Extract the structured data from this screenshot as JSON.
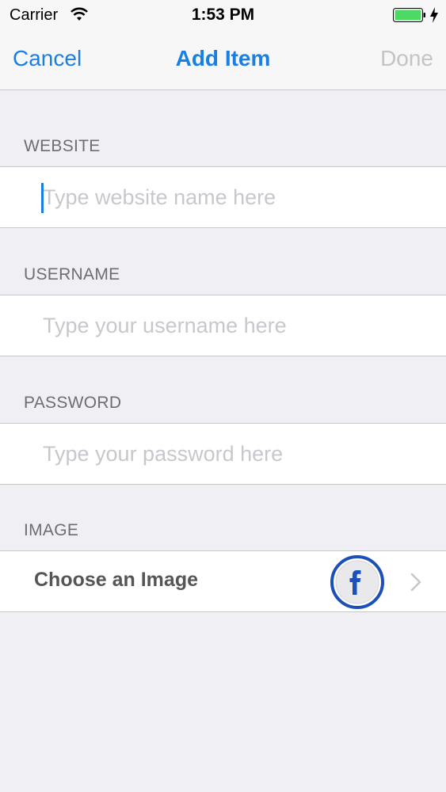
{
  "status_bar": {
    "carrier": "Carrier",
    "time": "1:53 PM"
  },
  "nav": {
    "cancel_label": "Cancel",
    "title": "Add Item",
    "done_label": "Done"
  },
  "form": {
    "website": {
      "header": "WEBSITE",
      "value": "",
      "placeholder": "Type website name here"
    },
    "username": {
      "header": "USERNAME",
      "value": "",
      "placeholder": "Type your username here"
    },
    "password": {
      "header": "PASSWORD",
      "value": "",
      "placeholder": "Type your password here"
    },
    "image": {
      "header": "IMAGE",
      "label": "Choose an Image",
      "selected_icon": "facebook-icon"
    }
  },
  "colors": {
    "accent": "#1a7fe3",
    "disabled": "#c4c4c6",
    "background": "#efeff4"
  }
}
